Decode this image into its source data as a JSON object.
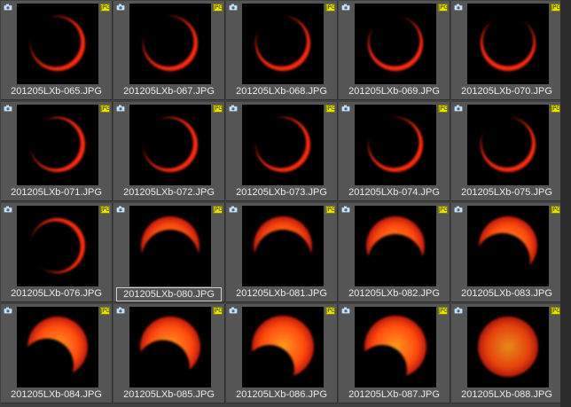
{
  "thumbnails": [
    {
      "filename": "201205LXb-065.JPG",
      "badge": "JPG",
      "phase": "ring-thin",
      "rot": 220
    },
    {
      "filename": "201205LXb-067.JPG",
      "badge": "JPG",
      "phase": "ring-thin",
      "rot": 230
    },
    {
      "filename": "201205LXb-068.JPG",
      "badge": "JPG",
      "phase": "ring-thin",
      "rot": 240
    },
    {
      "filename": "201205LXb-069.JPG",
      "badge": "JPG",
      "phase": "ring-thin",
      "rot": 250
    },
    {
      "filename": "201205LXb-070.JPG",
      "badge": "JPG",
      "phase": "ring-thin",
      "rot": 270
    },
    {
      "filename": "201205LXb-071.JPG",
      "badge": "JPG",
      "phase": "ring-thin",
      "rot": 205
    },
    {
      "filename": "201205LXb-072.JPG",
      "badge": "JPG",
      "phase": "ring-thin",
      "rot": 210
    },
    {
      "filename": "201205LXb-073.JPG",
      "badge": "JPG",
      "phase": "ring-thin",
      "rot": 220
    },
    {
      "filename": "201205LXb-074.JPG",
      "badge": "JPG",
      "phase": "ring-thin",
      "rot": 230
    },
    {
      "filename": "201205LXb-075.JPG",
      "badge": "JPG",
      "phase": "ring-thin",
      "rot": 240
    },
    {
      "filename": "201205LXb-076.JPG",
      "badge": "JPG",
      "phase": "ring-thin",
      "rot": 160
    },
    {
      "filename": "201205LXb-080.JPG",
      "badge": "JPG",
      "phase": "crescent",
      "rot": 180,
      "selected": true
    },
    {
      "filename": "201205LXb-081.JPG",
      "badge": "JPG",
      "phase": "crescent",
      "rot": 180
    },
    {
      "filename": "201205LXb-082.JPG",
      "badge": "JPG",
      "phase": "crescent-thick",
      "rot": 180
    },
    {
      "filename": "201205LXb-083.JPG",
      "badge": "JPG",
      "phase": "crescent-thick",
      "rot": 200
    },
    {
      "filename": "201205LXb-084.JPG",
      "badge": "JPG",
      "phase": "partial",
      "rot": 210
    },
    {
      "filename": "201205LXb-085.JPG",
      "badge": "JPG",
      "phase": "partial",
      "rot": 200
    },
    {
      "filename": "201205LXb-086.JPG",
      "badge": "JPG",
      "phase": "partial-small",
      "rot": 210
    },
    {
      "filename": "201205LXb-087.JPG",
      "badge": "JPG",
      "phase": "partial-small",
      "rot": 210
    },
    {
      "filename": "201205LXb-088.JPG",
      "badge": "JPG",
      "phase": "full-hazy",
      "rot": 0
    }
  ],
  "colors": {
    "sun_bright": "#ff9a1c",
    "sun_mid": "#ff4a10",
    "sun_edge": "#c01a08",
    "ring": "#ff2a10"
  }
}
